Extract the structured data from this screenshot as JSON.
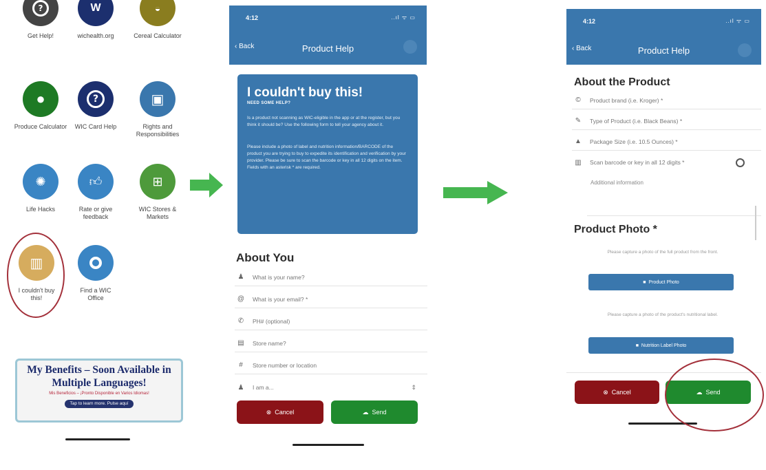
{
  "colors": {
    "accent": "#3a77ad",
    "cancel": "#8b1318",
    "send": "#1f8a2e",
    "arrow": "#46b650",
    "highlight": "#a3303a"
  },
  "screen1": {
    "tiles": [
      {
        "label": "Get Help!",
        "icon": "question-icon"
      },
      {
        "label": "wichealth.org",
        "icon": "wichealth-logo-icon"
      },
      {
        "label": "Cereal Calculator",
        "icon": "cereal-bowl-icon"
      },
      {
        "label": "Produce Calculator",
        "icon": "apple-icon"
      },
      {
        "label": "WIC Card Help",
        "icon": "question-icon"
      },
      {
        "label": "Rights and Responsibilities",
        "icon": "clipboard-icon"
      },
      {
        "label": "Life Hacks",
        "icon": "lightbulb-icon"
      },
      {
        "label": "Rate or give feedback",
        "icon": "thumbs-up-icon"
      },
      {
        "label": "WIC Stores & Markets",
        "icon": "basket-icon"
      },
      {
        "label": "I couldn't buy this!",
        "icon": "barcode-icon"
      },
      {
        "label": "Find a WIC Office",
        "icon": "map-pin-icon"
      }
    ],
    "banner": {
      "title": "My Benefits – Soon Available in Multiple Languages!",
      "subtitle": "Mis Beneficios – ¡Pronto Disponible en Varios Idiomas!",
      "tap": "Tap to learn more. Pulse aquí"
    }
  },
  "screen2": {
    "status": {
      "time": "4:12",
      "signal": "..ıl ᯤ ▭"
    },
    "header": {
      "back": "Back",
      "title": "Product Help"
    },
    "card": {
      "title": "I couldn't buy this!",
      "subtitle": "NEED SOME HELP?",
      "para1": "Is a product not scanning as WIC-eligible in the app or at the register, but you think it should be? Use the following form to tell your agency about it.",
      "para2": "Please include a photo of label and nutrition information/BARCODE of the product you are trying to buy to expedite its identification and verification by your provider. Please be sure to scan the barcode or key in all 12 digits on the item. Fields with an asterisk * are required."
    },
    "section": "About You",
    "fields": [
      {
        "icon": "person-icon",
        "glyph": "♟",
        "placeholder": "What is your name?"
      },
      {
        "icon": "at-icon",
        "glyph": "@",
        "placeholder": "What is your email? *"
      },
      {
        "icon": "phone-icon",
        "glyph": "✆",
        "placeholder": "PH# (optional)"
      },
      {
        "icon": "store-icon",
        "glyph": "▤",
        "placeholder": "Store name?"
      },
      {
        "icon": "hash-icon",
        "glyph": "#",
        "placeholder": "Store number or location"
      },
      {
        "icon": "user-role-icon",
        "glyph": "♟",
        "placeholder": "I am a..."
      }
    ],
    "cancel": "Cancel",
    "send": "Send"
  },
  "screen3": {
    "status": {
      "time": "4:12",
      "signal": "..ıl ᯤ ▭"
    },
    "header": {
      "back": "Back",
      "title": "Product Help"
    },
    "section1": "About the Product",
    "fields": [
      {
        "icon": "copyright-icon",
        "glyph": "©",
        "placeholder": "Product brand (i.e. Kroger) *"
      },
      {
        "icon": "pencil-icon",
        "glyph": "✎",
        "placeholder": "Type of Product (i.e. Black Beans) *"
      },
      {
        "icon": "weight-icon",
        "glyph": "▲",
        "placeholder": "Package Size (i.e. 10.5 Ounces) *"
      },
      {
        "icon": "barcode-icon",
        "glyph": "▥",
        "placeholder": "Scan barcode or key in all 12 digits *"
      }
    ],
    "additional": "Additional information",
    "section2": "Product Photo *",
    "hint1": "Please capture a photo of the full product from the front.",
    "photo_btn": "Product Photo",
    "hint2": "Please capture a photo of the product's nutritional label.",
    "label_btn": "Nutrition Label Photo",
    "cancel": "Cancel",
    "send": "Send"
  }
}
